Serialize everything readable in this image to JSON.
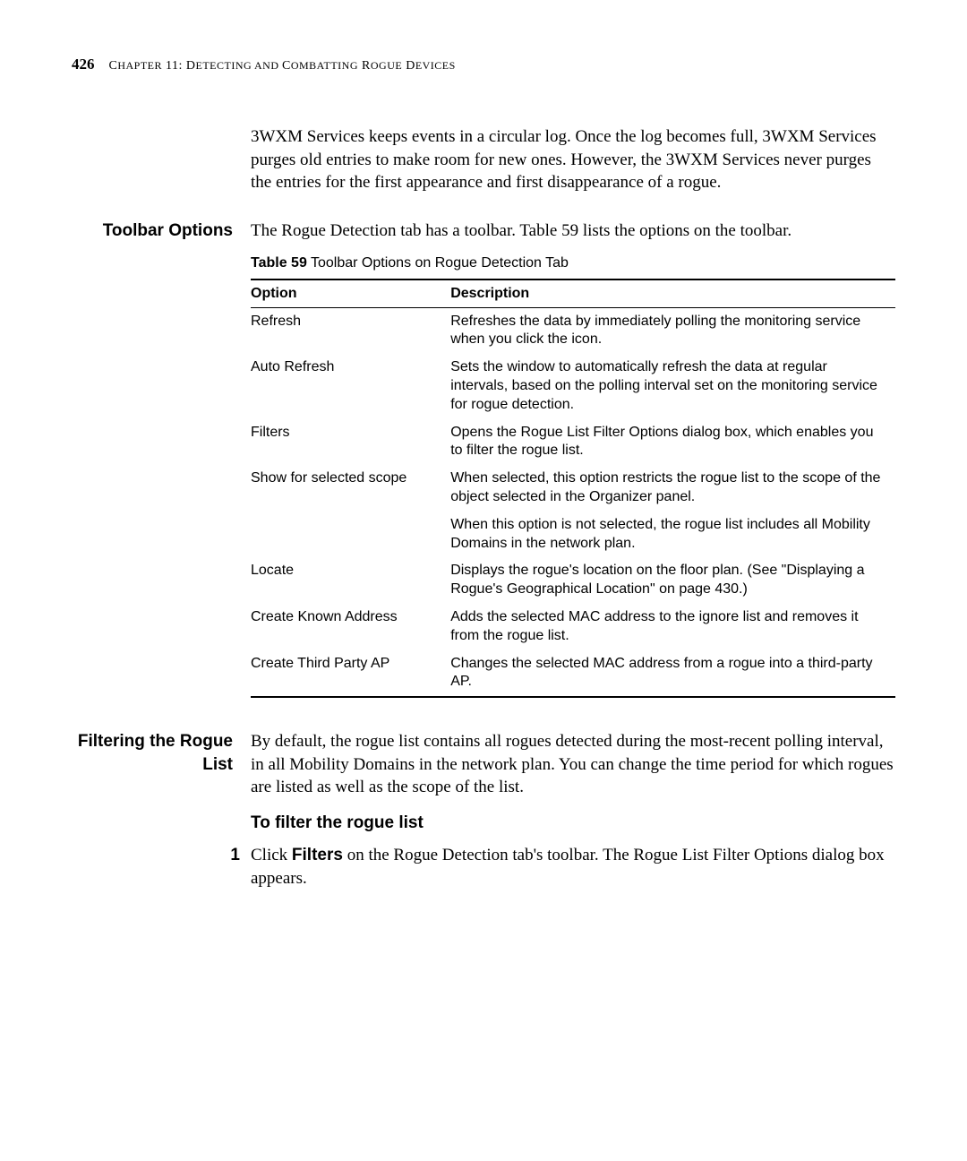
{
  "header": {
    "page_number": "426",
    "chapter_prefix": "C",
    "chapter_word": "HAPTER",
    "chapter_num": " 11: D",
    "chapter_rest1": "ETECTING",
    "and": " AND ",
    "chapter_rest2": "C",
    "chapter_rest3": "OMBATTING",
    "chapter_rest4": " R",
    "chapter_rest5": "OGUE",
    "chapter_rest6": " D",
    "chapter_rest7": "EVICES"
  },
  "intro_para": "3WXM Services keeps events in a circular log. Once the log becomes full, 3WXM Services purges old entries to make room for new ones. However, the 3WXM Services never purges the entries for the first appearance and first disappearance of a rogue.",
  "sections": {
    "toolbar": {
      "label": "Toolbar Options",
      "body": "The Rogue Detection tab has a toolbar. Table 59 lists the options on the toolbar."
    },
    "filters": {
      "label": "Filtering the Rogue List",
      "body": "By default, the rogue list contains all rogues detected during the most-recent polling interval, in all Mobility Domains in the network plan. You can change the time period for which rogues are listed as well as the scope of the list."
    }
  },
  "table": {
    "caption_label": "Table 59",
    "caption_text": "   Toolbar Options on Rogue Detection Tab",
    "headers": {
      "col1": "Option",
      "col2": "Description"
    },
    "rows": [
      {
        "option": "Refresh",
        "desc": "Refreshes the data by immediately polling the monitoring service when you click the icon."
      },
      {
        "option": "Auto Refresh",
        "desc": "Sets the window to automatically refresh the data at regular intervals, based on the polling interval set on the monitoring service for rogue detection."
      },
      {
        "option": "Filters",
        "desc": "Opens the Rogue List Filter Options dialog box, which enables you to filter the rogue list."
      },
      {
        "option": "Show for selected scope",
        "desc": "When selected, this option restricts the rogue list to the scope of the object selected in the Organizer panel."
      },
      {
        "option": "",
        "desc": "When this option is not selected, the rogue list includes all Mobility Domains in the network plan."
      },
      {
        "option": "Locate",
        "desc": "Displays the rogue's location on the floor plan. (See \"Displaying a Rogue's Geographical Location\" on page 430.)"
      },
      {
        "option": "Create Known Address",
        "desc": "Adds the selected MAC address to the ignore list and removes it from the rogue list."
      },
      {
        "option": "Create Third Party AP",
        "desc": "Changes the selected MAC address from a rogue into a third-party AP."
      }
    ]
  },
  "subheading": "To filter the rogue list",
  "step1": {
    "num": "1",
    "pre": "Click ",
    "bold": "Filters",
    "post": " on the Rogue Detection tab's toolbar. The Rogue List Filter Options dialog box appears."
  }
}
